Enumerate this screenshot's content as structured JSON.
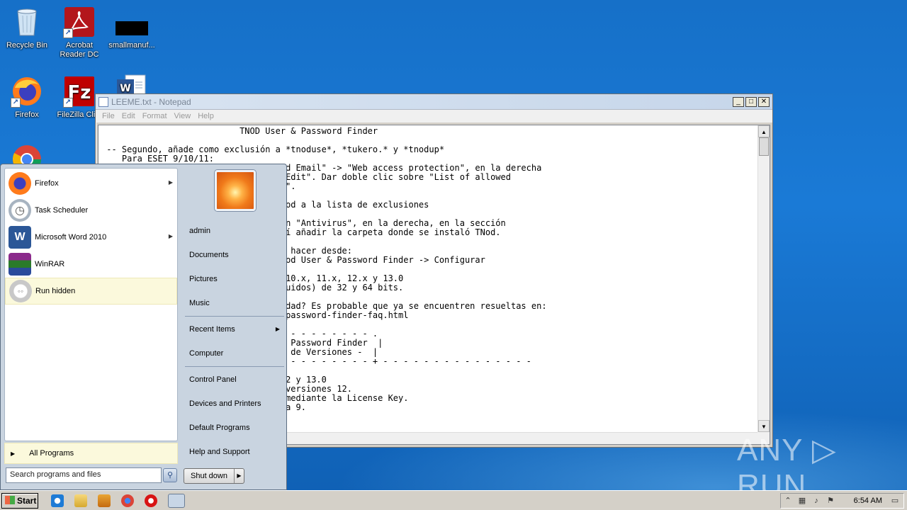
{
  "desktop": {
    "icons": [
      {
        "label": "Recycle Bin"
      },
      {
        "label": "Acrobat Reader DC"
      },
      {
        "label": "smallmanuf..."
      },
      {
        "label": "Firefox"
      },
      {
        "label": "FileZilla Cli..."
      },
      {
        "label": ""
      },
      {
        "label": ""
      }
    ]
  },
  "notepad": {
    "title": "LEEME.txt - Notepad",
    "menu": [
      "File",
      "Edit",
      "Format",
      "View",
      "Help"
    ],
    "lines": [
      "                           TNOD User & Password Finder",
      "",
      " -- Segundo, añade como exclusión a *tnoduse*, *tukero.* y *tnodup*",
      "    Para ESET 9/10/11:",
      "                           a \"Web and Email\" -> \"Web access protection\", en la derecha",
      "                         ement\" -> \"Edit\". Dar doble clic sobre \"List of allowed",
      "                         lic en \"Add\".",
      "",
      "                         ecutable TNod a la lista de exclusiones",
      "",
      "                         n la sección \"Antivirus\", en la derecha, en la sección",
      "                         \"Edit\" y ahí añadir la carpeta donde se instaló TNod.",
      "",
      "                         : Lo puedes hacer desde:",
      "                         ramas -> TNod User & Password Finder -> Configurar",
      "",
      "                         NOD32 9.x, 10.x, 11.x, 12.x y 13.0",
      "                         curity incluidos) de 32 y 64 bits.",
      "",
      "                          esta utilidad? Es probable que ya se encuentren resueltas en:",
      "                         /tnod-user-password-finder-faq.html",
      "",
      "                         - - - - - - - - - - - - - - .",
      "                         TNod User & Password Finder  |",
      "                         - Historial de Versiones -  |",
      "                         - - - - - - - - - - - - - - + - - - - - - - - - - - - - - -",
      "",
      "                         version 12.2 y 13.0",
      "                         s casos de versiones 12.",
      "                         se realiza mediante la License Key.",
      "                         eriores a la 9."
    ]
  },
  "start_menu": {
    "programs": [
      {
        "label": "Firefox",
        "has_submenu": true
      },
      {
        "label": "Task Scheduler",
        "has_submenu": false
      },
      {
        "label": "Microsoft Word 2010",
        "has_submenu": true
      },
      {
        "label": "WinRAR",
        "has_submenu": false
      },
      {
        "label": "Run hidden",
        "has_submenu": false
      }
    ],
    "all_programs": "All Programs",
    "search_placeholder": "Search programs and files",
    "right_items": {
      "user": "admin",
      "documents": "Documents",
      "pictures": "Pictures",
      "music": "Music",
      "recent_items": "Recent Items",
      "computer": "Computer",
      "control_panel": "Control Panel",
      "devices_printers": "Devices and Printers",
      "default_programs": "Default Programs",
      "help_support": "Help and Support"
    },
    "shutdown": "Shut down"
  },
  "taskbar": {
    "start_label": "Start",
    "clock": "6:54 AM"
  },
  "watermark": "ANY ▷ RUN"
}
